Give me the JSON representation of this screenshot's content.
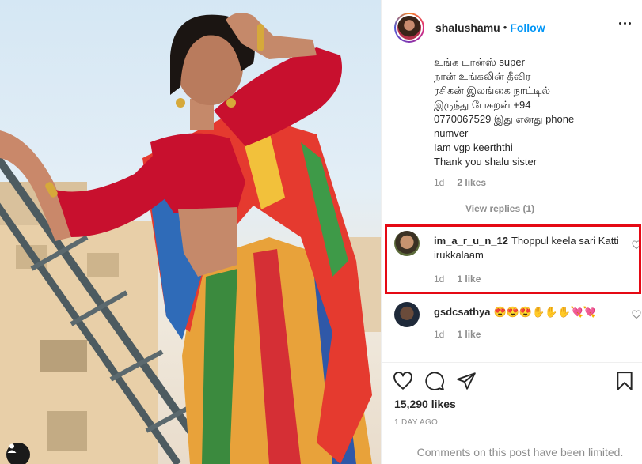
{
  "post": {
    "username": "shalushamu",
    "separator": "•",
    "follow_label": "Follow"
  },
  "top_comment": {
    "lines": [
      "உங்க டான்ஸ் super",
      "நான் உங்கலின் தீவிர",
      "ரசிகன் இலங்கை நாட்டில்",
      "இருந்து பேசுறன் +94",
      "0770067529 இது எனது phone",
      "numver",
      "Iam vgp keerththi",
      "Thank you shalu sister"
    ],
    "age": "1d",
    "likes": "2 likes",
    "view_replies": "View replies (1)"
  },
  "comments": [
    {
      "username": "im_a_r_u_n_12",
      "text": "Thoppul keela sari Katti irukkalaam",
      "age": "1d",
      "likes": "1 like",
      "highlighted": true
    },
    {
      "username": "gsdcsathya",
      "text": "😍😍😍✋✋✋💘💘",
      "age": "1d",
      "likes": "1 like",
      "highlighted": false
    }
  ],
  "footer": {
    "likes_count": "15,290 likes",
    "timestamp": "1 DAY AGO",
    "comments_limited": "Comments on this post have been limited."
  },
  "icons": {
    "like": "heart-icon",
    "comment": "comment-icon",
    "share": "paper-plane-icon",
    "save": "bookmark-icon",
    "more": "more-options-icon",
    "user_tag": "user-tag-icon"
  },
  "colors": {
    "follow": "#0095f6",
    "highlight_box": "#e50914",
    "muted_text": "#8e8e8e"
  }
}
